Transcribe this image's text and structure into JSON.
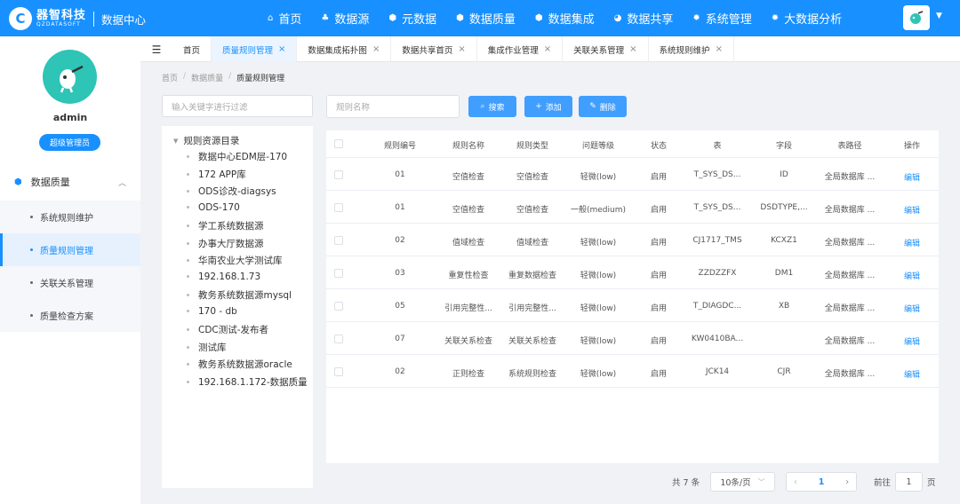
{
  "brand": {
    "name_cn": "器智科技",
    "name_en": "QZDATASOFT",
    "system": "数据中心"
  },
  "nav": [
    {
      "label": "首页",
      "icon": "home-icon",
      "glyph": "⌂"
    },
    {
      "label": "数据源",
      "icon": "cluster-icon",
      "glyph": "♣"
    },
    {
      "label": "元数据",
      "icon": "hexagon-icon",
      "glyph": "⬢"
    },
    {
      "label": "数据质量",
      "icon": "hexagon-icon",
      "glyph": "⬢"
    },
    {
      "label": "数据集成",
      "icon": "shield-icon",
      "glyph": "⬢"
    },
    {
      "label": "数据共享",
      "icon": "pie-icon",
      "glyph": "◕"
    },
    {
      "label": "系统管理",
      "icon": "gear-icon",
      "glyph": "✹"
    },
    {
      "label": "大数据分析",
      "icon": "gear-icon",
      "glyph": "✹"
    }
  ],
  "user": {
    "name": "admin",
    "role": "超级管理员"
  },
  "sidebar": {
    "parent": "数据质量",
    "items": [
      {
        "label": "系统规则维护",
        "active": false
      },
      {
        "label": "质量规则管理",
        "active": true
      },
      {
        "label": "关联关系管理",
        "active": false
      },
      {
        "label": "质量检查方案",
        "active": false
      }
    ]
  },
  "tabs": [
    {
      "label": "首页",
      "closable": false,
      "active": false
    },
    {
      "label": "质量规则管理",
      "closable": true,
      "active": true
    },
    {
      "label": "数据集成拓扑图",
      "closable": true,
      "active": false
    },
    {
      "label": "数据共享首页",
      "closable": true,
      "active": false
    },
    {
      "label": "集成作业管理",
      "closable": true,
      "active": false
    },
    {
      "label": "关联关系管理",
      "closable": true,
      "active": false
    },
    {
      "label": "系统规则维护",
      "closable": true,
      "active": false
    }
  ],
  "tab_close_glyph": "×",
  "breadcrumb": [
    "首页",
    "数据质量",
    "质量规则管理"
  ],
  "tree": {
    "filter_placeholder": "输入关键字进行过滤",
    "root": "规则资源目录",
    "nodes": [
      "数据中心EDM层-170",
      "172 APP库",
      "ODS诊改-diagsys",
      "ODS-170",
      "学工系统数据源",
      "办事大厅数据源",
      "华南农业大学测试库",
      "192.168.1.73",
      "教务系统数据源mysql",
      "170 - db",
      "CDC测试-发布者",
      "测试库",
      "教务系统数据源oracle",
      "192.168.1.172-数据质量"
    ]
  },
  "toolbar": {
    "search_placeholder": "规则名称",
    "search_label": "搜索",
    "add_label": "添加",
    "delete_label": "删除"
  },
  "table": {
    "columns": [
      "规则编号",
      "规则名称",
      "规则类型",
      "问题等级",
      "状态",
      "表",
      "字段",
      "表路径",
      "操作"
    ],
    "rows": [
      [
        "01",
        "空值检查",
        "空值检查",
        "轻微(low)",
        "启用",
        "T_SYS_DS...",
        "ID",
        "全局数据库 ...",
        "编辑"
      ],
      [
        "01",
        "空值检查",
        "空值检查",
        "一般(medium)",
        "启用",
        "T_SYS_DS...",
        "DSDTYPE,...",
        "全局数据库 ...",
        "编辑"
      ],
      [
        "02",
        "值域检查",
        "值域检查",
        "轻微(low)",
        "启用",
        "CJ1717_TMS",
        "KCXZ1",
        "全局数据库 ...",
        "编辑"
      ],
      [
        "03",
        "重复性检查",
        "重复数据检查",
        "轻微(low)",
        "启用",
        "ZZDZZFX",
        "DM1",
        "全局数据库 ...",
        "编辑"
      ],
      [
        "05",
        "引用完整性...",
        "引用完整性...",
        "轻微(low)",
        "启用",
        "T_DIAGDC...",
        "XB",
        "全局数据库 ...",
        "编辑"
      ],
      [
        "07",
        "关联关系检查",
        "关联关系检查",
        "轻微(low)",
        "启用",
        "KW0410BA...",
        "",
        "全局数据库 ...",
        "编辑"
      ],
      [
        "02",
        "正则检查",
        "系统规则检查",
        "轻微(low)",
        "启用",
        "JCK14",
        "CJR",
        "全局数据库 ...",
        "编辑"
      ]
    ]
  },
  "pagination": {
    "total_text": "共 7 条",
    "page_size": "10条/页",
    "current_page": "1",
    "prev_glyph": "‹",
    "next_glyph": "›",
    "goto_label": "前往",
    "goto_value": "1",
    "page_unit": "页"
  },
  "colors": {
    "primary": "#1890ff",
    "button": "#409eff",
    "avatar": "#2ec4b6"
  }
}
